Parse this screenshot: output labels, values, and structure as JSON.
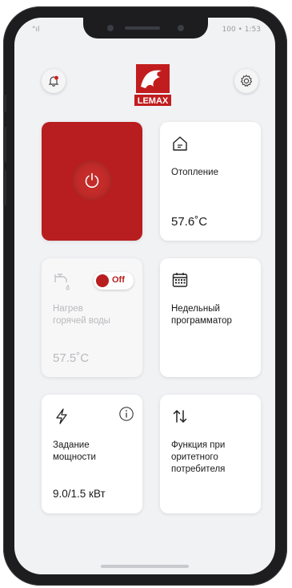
{
  "status_bar": {
    "left": "°ıl",
    "right": "100 • 1:53"
  },
  "header": {
    "logo_text": "LEMAX",
    "alarm_icon": "bell-alert-icon",
    "settings_icon": "gear-icon"
  },
  "tiles": {
    "power": {
      "icon": "power-icon",
      "on": true
    },
    "heating": {
      "icon": "home-icon",
      "title": "Отопление",
      "value": "57.6˚C"
    },
    "hot_water": {
      "icon": "faucet-icon",
      "title": "Нагрев\nгорячей воды",
      "value": "57.5˚C",
      "toggle_label": "Off",
      "enabled": false
    },
    "scheduler": {
      "icon": "calendar-icon",
      "title": "Недельный\nпрограмматор"
    },
    "power_setting": {
      "icon": "lightning-icon",
      "info_icon": "info-icon",
      "title": "Задание\nмощности",
      "value": "9.0/1.5 кВт"
    },
    "priority": {
      "icon": "swap-arrows-icon",
      "title": "Функция при\nоритетного\nпотребителя"
    }
  },
  "colors": {
    "brand_red": "#b81e1f",
    "background": "#f1f2f4",
    "card": "#ffffff",
    "disabled_text": "#b9b9bd"
  }
}
